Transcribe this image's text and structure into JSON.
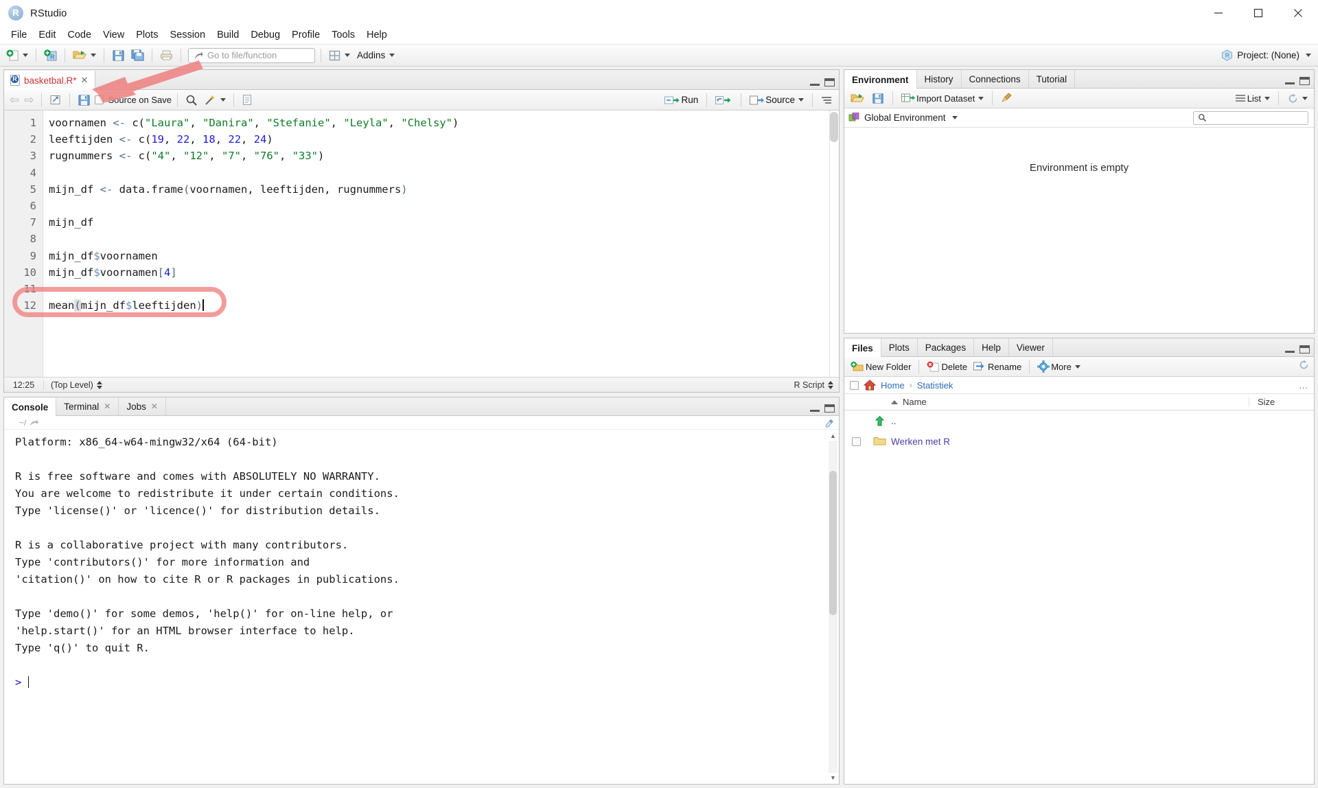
{
  "window": {
    "app_title": "RStudio",
    "logo_letter": "R",
    "minimize": "—",
    "maximize": "▢",
    "close": "✕"
  },
  "menubar": {
    "items": [
      "File",
      "Edit",
      "Code",
      "View",
      "Plots",
      "Session",
      "Build",
      "Debug",
      "Profile",
      "Tools",
      "Help"
    ]
  },
  "toolbar": {
    "goto_placeholder": "Go to file/function",
    "addins_label": "Addins",
    "project_label": "Project: (None)",
    "icons": [
      "new-file-icon",
      "new-project-icon",
      "open-file-icon",
      "save-icon",
      "save-all-icon",
      "print-icon",
      "grid-icon"
    ]
  },
  "source": {
    "tab": {
      "filename": "basketbal.R*",
      "close_glyph": "✕"
    },
    "toolbar": {
      "back_glyph": "⇦",
      "forward_glyph": "⇨",
      "source_on_save_label": "Source on Save",
      "run_label": "Run",
      "source_label": "Source"
    },
    "gutter": [
      "1",
      "2",
      "3",
      "4",
      "5",
      "6",
      "7",
      "8",
      "9",
      "10",
      "11",
      "12"
    ],
    "code_lines": [
      "voornamen <- c(\"Laura\", \"Danira\", \"Stefanie\", \"Leyla\", \"Chelsy\")",
      "leeftijden <- c(19, 22, 18, 22, 24)",
      "rugnummers <- c(\"4\", \"12\", \"7\", \"76\", \"33\")",
      "",
      "mijn_df <- data.frame(voornamen, leeftijden, rugnummers)",
      "",
      "mijn_df",
      "",
      "mijn_df$voornamen",
      "mijn_df$voornamen[4]",
      "",
      "mean(mijn_df$leeftijden)"
    ],
    "statusbar": {
      "position": "12:25",
      "scope": "(Top Level)",
      "filetype": "R Script"
    }
  },
  "console": {
    "tabs": [
      {
        "label": "Console",
        "closable": false
      },
      {
        "label": "Terminal",
        "closable": true
      },
      {
        "label": "Jobs",
        "closable": true
      }
    ],
    "path": "~/",
    "lines": [
      "Platform: x86_64-w64-mingw32/x64 (64-bit)",
      "",
      "R is free software and comes with ABSOLUTELY NO WARRANTY.",
      "You are welcome to redistribute it under certain conditions.",
      "Type 'license()' or 'licence()' for distribution details.",
      "",
      "R is a collaborative project with many contributors.",
      "Type 'contributors()' for more information and",
      "'citation()' on how to cite R or R packages in publications.",
      "",
      "Type 'demo()' for some demos, 'help()' for on-line help, or",
      "'help.start()' for an HTML browser interface to help.",
      "Type 'q()' to quit R."
    ],
    "prompt": ">"
  },
  "environment": {
    "tabs": [
      "Environment",
      "History",
      "Connections",
      "Tutorial"
    ],
    "active_tab": "Environment",
    "toolbar": {
      "import_dataset_label": "Import Dataset",
      "list_label": "List",
      "broom_icon": "broom-icon",
      "refresh_icon": "refresh-icon"
    },
    "scope_label": "Global Environment",
    "search_placeholder": "",
    "empty_message": "Environment is empty"
  },
  "files": {
    "tabs": [
      "Files",
      "Plots",
      "Packages",
      "Help",
      "Viewer"
    ],
    "active_tab": "Files",
    "toolbar": {
      "new_folder_label": "New Folder",
      "delete_label": "Delete",
      "rename_label": "Rename",
      "more_label": "More"
    },
    "breadcrumb": [
      "Home",
      "Statistiek"
    ],
    "breadcrumb_overflow": "…",
    "columns": {
      "name": "Name",
      "size": "Size"
    },
    "rows": [
      {
        "name": "..",
        "size": "",
        "is_parent": true
      },
      {
        "name": "Werken met R",
        "size": "",
        "is_parent": false
      }
    ]
  },
  "annotations": {
    "oval_color": "#f08080",
    "arrow_color": "#ef8080",
    "highlighted_line": "mean(mijn_df$leeftijden)"
  }
}
